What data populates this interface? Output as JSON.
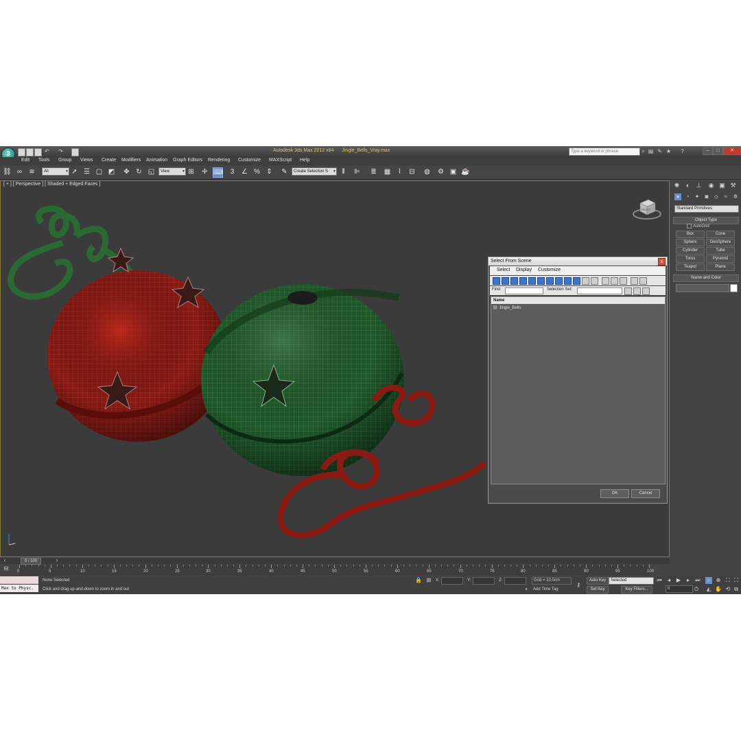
{
  "app": {
    "title": "Autodesk 3ds Max 2012 x64",
    "file": "Jingle_Bells_Vray.max",
    "logo_icon": "3dsmax-logo-icon"
  },
  "search": {
    "placeholder": "Type a keyword or phrase"
  },
  "menu": [
    "Edit",
    "Tools",
    "Group",
    "Views",
    "Create",
    "Modifiers",
    "Animation",
    "Graph Editors",
    "Rendering",
    "Customize",
    "MAXScript",
    "Help"
  ],
  "toolbar": {
    "selection_filter": "All",
    "ref_coord": "View",
    "named_sel": "Create Selection S"
  },
  "viewport": {
    "label": "[ + ] [ Perspective ] [ Shaded + Edged Faces ]",
    "viewcube_label": "FRONT"
  },
  "dialog": {
    "title": "Select From Scene",
    "close": "x",
    "menu": [
      "Select",
      "Display",
      "Customize"
    ],
    "find_label": "Find:",
    "selection_set_label": "Selection Set:",
    "column_name": "Name",
    "items": [
      "Jingle_Bells"
    ],
    "ok": "OK",
    "cancel": "Cancel"
  },
  "command_panel": {
    "category": "Standard Primitives",
    "object_type": "Object Type",
    "autogrid": "AutoGrid",
    "buttons": [
      "Box",
      "Cone",
      "Sphere",
      "GeoSphere",
      "Cylinder",
      "Tube",
      "Torus",
      "Pyramid",
      "Teapot",
      "Plane"
    ],
    "name_and_color": "Name and Color",
    "object_color": "#ffffff"
  },
  "timeline": {
    "frame_display": "0 / 100",
    "ticks": [
      "0",
      "5",
      "10",
      "15",
      "20",
      "25",
      "30",
      "35",
      "40",
      "45",
      "50",
      "55",
      "60",
      "65",
      "70",
      "75",
      "80",
      "85",
      "90",
      "95",
      "100"
    ]
  },
  "status": {
    "maxscript": "Max to Physc.",
    "selection": "None Selected",
    "prompt": "Click and drag up-and-down to zoom in and out",
    "x_label": "X:",
    "y_label": "Y:",
    "z_label": "Z:",
    "grid": "Grid = 10,0cm",
    "add_time_tag": "Add Time Tag",
    "auto_key": "Auto Key",
    "set_key": "Set Key",
    "key_mode": "Selected",
    "key_filters": "Key Filters...",
    "current_frame": "0"
  },
  "colors": {
    "red_bell": "#8a1a14",
    "green_bell": "#1f5a2a",
    "wire": "#9a9a9a",
    "title_accent": "#e8c26a"
  }
}
